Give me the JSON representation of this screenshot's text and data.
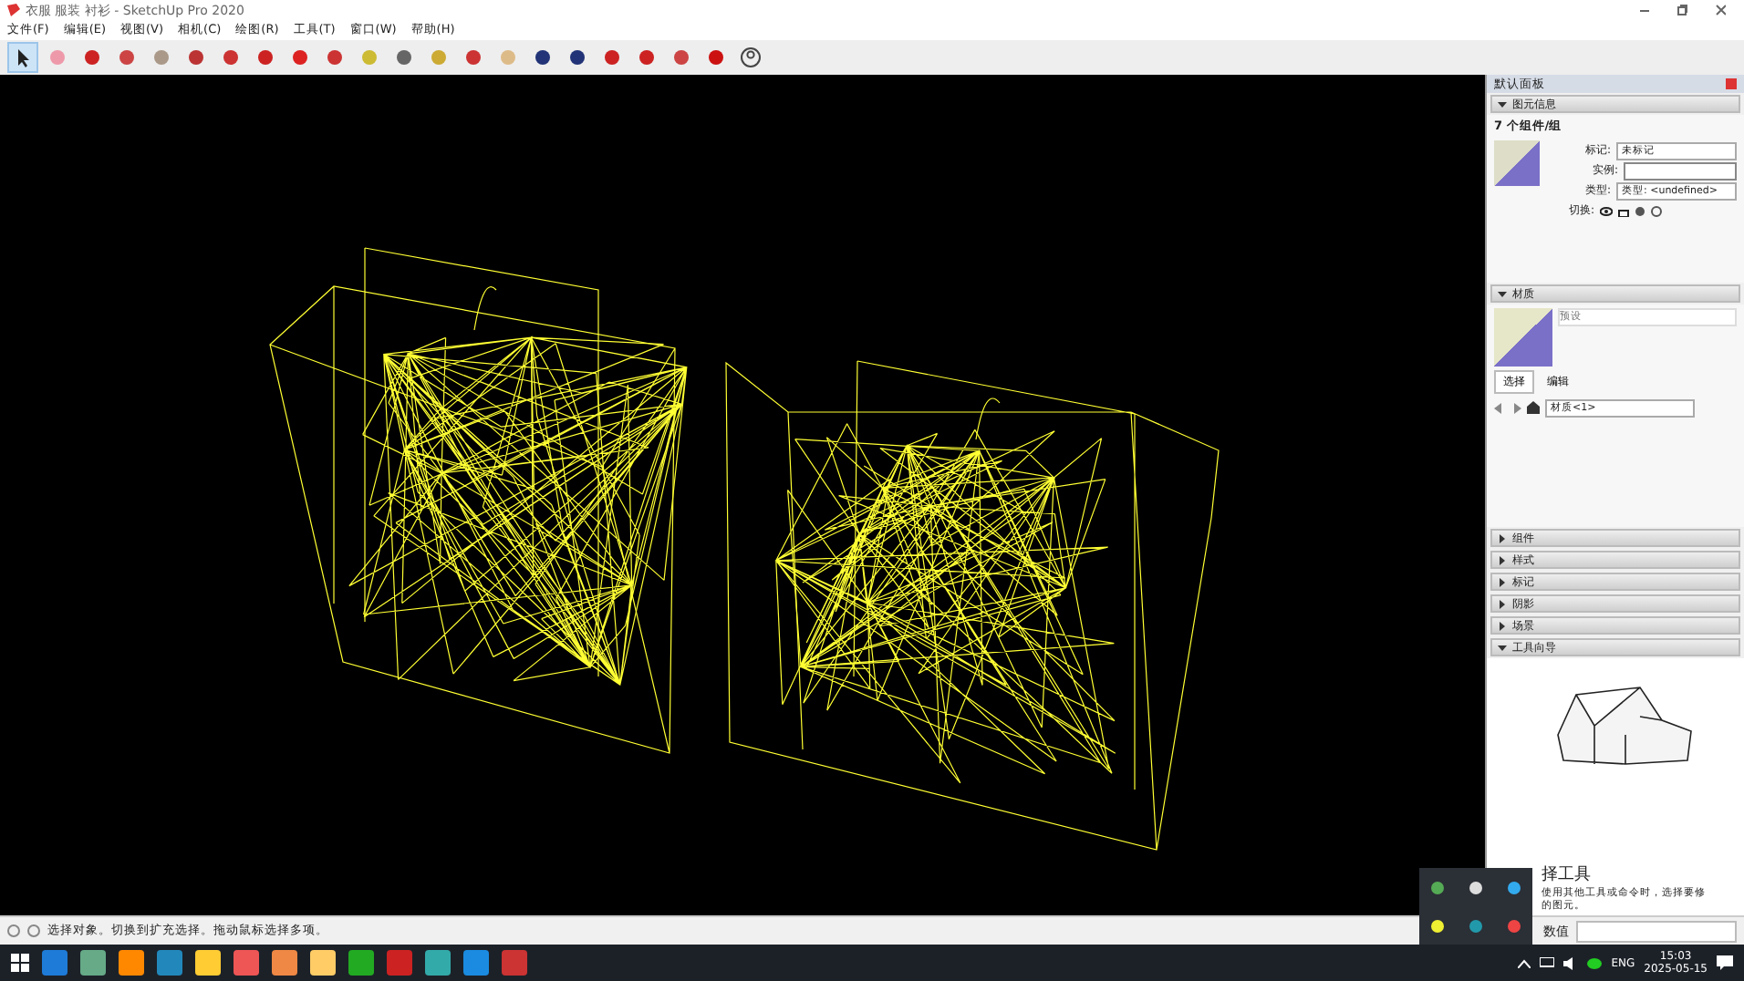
{
  "window": {
    "title": "衣服 服装 衬衫 - SketchUp Pro 2020"
  },
  "menu": [
    "文件(F)",
    "编辑(E)",
    "视图(V)",
    "相机(C)",
    "绘图(R)",
    "工具(T)",
    "窗口(W)",
    "帮助(H)"
  ],
  "toolbar": [
    {
      "kind": "select",
      "selected": true
    },
    {
      "kind": "eraser",
      "selected": false
    },
    {
      "kind": "pencil",
      "selected": false
    },
    {
      "kind": "arc",
      "selected": false
    },
    {
      "kind": "paint",
      "selected": false
    },
    {
      "kind": "pushpull",
      "selected": false
    },
    {
      "kind": "followme",
      "selected": false
    },
    {
      "kind": "move",
      "selected": false
    },
    {
      "kind": "rotate",
      "selected": false
    },
    {
      "kind": "scale",
      "selected": false
    },
    {
      "kind": "tape",
      "selected": false
    },
    {
      "kind": "text",
      "selected": false
    },
    {
      "kind": "paint2",
      "selected": false
    },
    {
      "kind": "orbit",
      "selected": false
    },
    {
      "kind": "pan",
      "selected": false
    },
    {
      "kind": "zoom",
      "selected": false
    },
    {
      "kind": "extents",
      "selected": false
    },
    {
      "kind": "warehouse",
      "selected": false
    },
    {
      "kind": "warehouse",
      "selected": false
    },
    {
      "kind": "extension",
      "selected": false
    },
    {
      "kind": "ruby",
      "selected": false
    },
    {
      "kind": "account",
      "selected": false
    }
  ],
  "panel": {
    "title": "默认面板",
    "entity_info": {
      "title": "图元信息",
      "summary": "7 个组件/组",
      "tag_label": "标记:",
      "tag_value": "未标记",
      "instance_label": "实例:",
      "type_label": "类型:",
      "type_value": "类型: <undefined>",
      "toggle_label": "切换:"
    },
    "materials": {
      "title": "材质",
      "placeholder": "预设",
      "tabs": [
        {
          "label": "选择",
          "selected": true
        },
        {
          "label": "编辑",
          "selected": false
        }
      ],
      "collection": "材质<1>"
    },
    "sections": [
      {
        "title": "组件",
        "expanded": false
      },
      {
        "title": "样式",
        "expanded": false
      },
      {
        "title": "标记",
        "expanded": false
      },
      {
        "title": "阴影",
        "expanded": false
      },
      {
        "title": "场景",
        "expanded": false
      },
      {
        "title": "工具向导",
        "expanded": true
      }
    ],
    "guide": {
      "heading": "择工具",
      "text": "使用其他工具或命令时，选择要修",
      "text2": "的图元。"
    }
  },
  "status_bar": {
    "text": "选择对象。切换到扩充选择。拖动鼠标选择多项。",
    "measure_label": "数值"
  },
  "taskbar": {
    "lang": "ENG",
    "time": "15:03",
    "date": "2025-05-15"
  }
}
